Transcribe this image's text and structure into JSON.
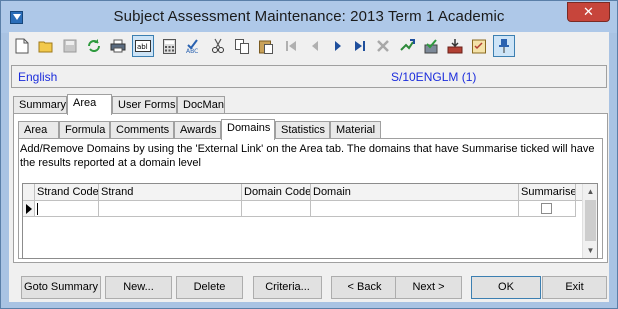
{
  "window": {
    "title": "Subject Assessment Maintenance:  2013 Term 1 Academic",
    "close_label": "✕"
  },
  "toolbar": {
    "icons": [
      "new-icon",
      "open-icon",
      "save-icon",
      "refresh-icon",
      "print-icon",
      "text-field-icon",
      "calculator-icon",
      "spellcheck-icon",
      "cut-icon",
      "copy-icon",
      "paste-icon",
      "first-record-icon",
      "previous-record-icon",
      "next-record-icon",
      "last-record-icon",
      "delete-icon",
      "go-icon",
      "approve-icon",
      "import-icon",
      "checklist-icon",
      "pin-icon"
    ]
  },
  "info": {
    "subject": "English",
    "code": "S/10ENGLM (1)"
  },
  "tabs": [
    "Summary",
    "Area",
    "User Forms",
    "DocMan"
  ],
  "subtabs": [
    "Area",
    "Formula",
    "Comments",
    "Awards",
    "Domains",
    "Statistics",
    "Material"
  ],
  "panel": {
    "description": "Add/Remove Domains by using the 'External Link' on the Area tab.  The domains that have Summarise ticked will have the results reported at a domain level"
  },
  "grid": {
    "columns": [
      "Strand Code",
      "Strand",
      "Domain Code",
      "Domain",
      "Summarise"
    ],
    "rows": [
      {
        "strand_code": "",
        "strand": "",
        "domain_code": "",
        "domain": "",
        "summarise": false
      }
    ]
  },
  "buttons": {
    "goto_summary": "Goto Summary",
    "new": "New...",
    "delete": "Delete",
    "criteria": "Criteria...",
    "back": "< Back",
    "next": "Next >",
    "ok": "OK",
    "exit": "Exit"
  }
}
